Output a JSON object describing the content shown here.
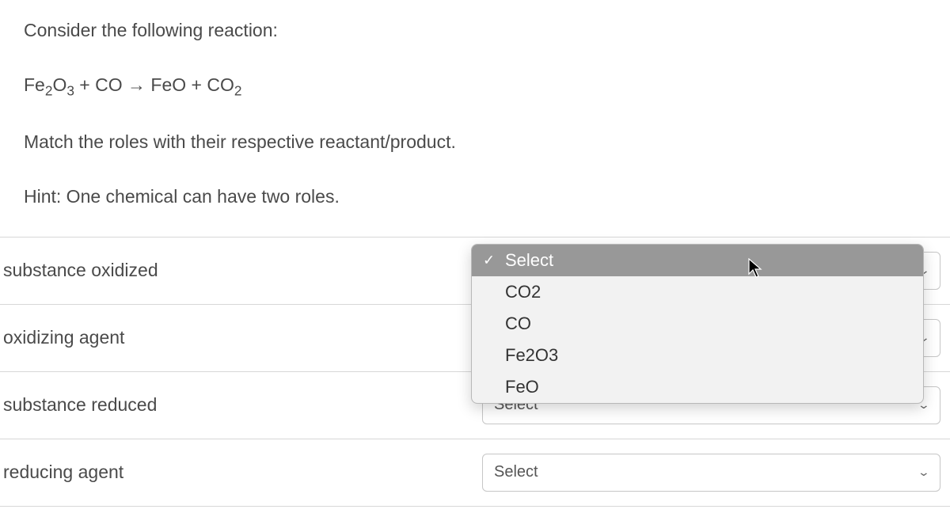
{
  "question": {
    "intro": "Consider the following reaction:",
    "equation_html": "Fe<sub>2</sub>O<sub>3</sub> + CO → FeO + CO<sub>2</sub>",
    "instruction": "Match the roles with their respective reactant/product.",
    "hint": "Hint: One chemical can have two roles."
  },
  "rows": [
    {
      "label": "substance oxidized",
      "selected": "Select"
    },
    {
      "label": "oxidizing agent",
      "selected": "Select"
    },
    {
      "label": "substance reduced",
      "selected": "Select"
    },
    {
      "label": "reducing agent",
      "selected": "Select"
    }
  ],
  "dropdown": {
    "open_for_row": 0,
    "highlighted_index": 0,
    "options": [
      "Select",
      "CO2",
      "CO",
      "Fe2O3",
      "FeO"
    ]
  }
}
